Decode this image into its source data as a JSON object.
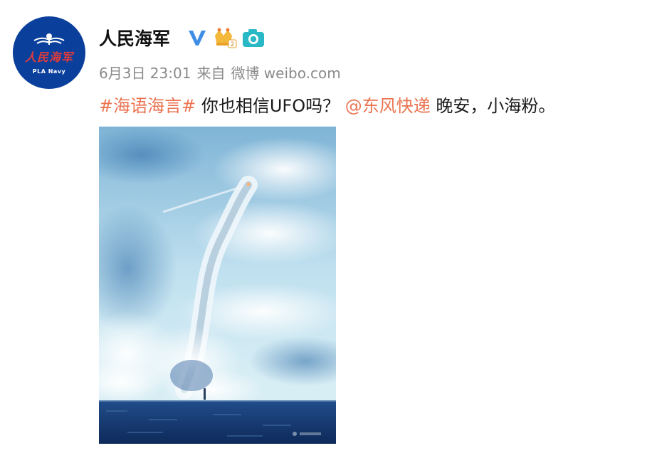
{
  "user": {
    "display_name": "人民海军",
    "avatar_calligraphy": "人民海军",
    "avatar_subtitle": "PLA Navy",
    "verified_icon": "verified-v-icon",
    "badges": [
      "crown-vip-icon",
      "camera-icon"
    ]
  },
  "post": {
    "date": "6月3日 23:01",
    "source_prefix": "来自",
    "source_app": "微博 weibo.com",
    "hashtag": "#海语海言#",
    "text_1": "你也相信UFO吗？",
    "mention": "@东风快递",
    "text_2": "晚安，小海粉。"
  },
  "image": {
    "subject": "submarine-launched-missile-photo"
  },
  "colors": {
    "link": "#eb7350",
    "meta": "#8a8a8a",
    "verified": "#3f8ee6",
    "avatar_bg": "#0a3f9c"
  }
}
